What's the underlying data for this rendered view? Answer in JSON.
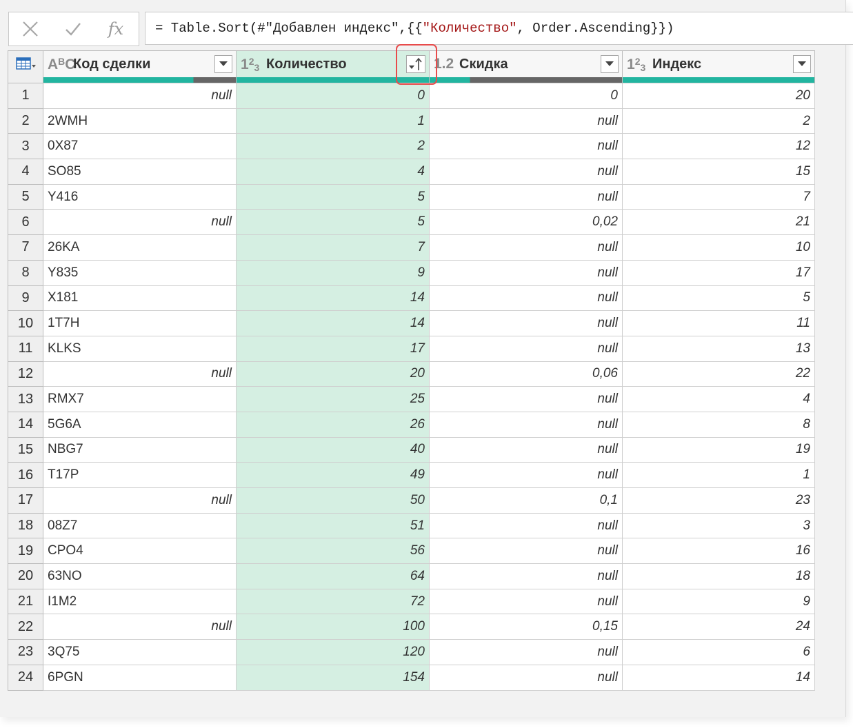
{
  "formula_bar": {
    "cancel_icon": "close-icon",
    "confirm_icon": "check-icon",
    "fx_label": "fx",
    "formula_prefix": "= Table.Sort(#\"Добавлен индекс\",{{",
    "formula_string": "\"Количество\"",
    "formula_suffix": ", Order.Ascending}})"
  },
  "colors": {
    "quality_green": "#22b5a0",
    "quality_gray": "#666666",
    "sorted_column_bg": "#d5efe2",
    "highlight_red": "#e84b4b",
    "string_literal": "#a31515"
  },
  "table": {
    "corner_icon": "table-icon",
    "columns": [
      {
        "key": "code",
        "label": "Код сделки",
        "type_icon": "ABC",
        "quality_valid": 0.78
      },
      {
        "key": "qty",
        "label": "Количество",
        "type_icon": "123",
        "quality_valid": 1.0,
        "sorted": "ascending"
      },
      {
        "key": "discount",
        "label": "Скидка",
        "type_icon": "1.2",
        "quality_valid": 0.21
      },
      {
        "key": "index",
        "label": "Индекс",
        "type_icon": "123",
        "quality_valid": 1.0
      }
    ],
    "rows": [
      {
        "n": "1",
        "code": "null",
        "qty": "0",
        "discount": "0",
        "index": "20"
      },
      {
        "n": "2",
        "code": "2WMH",
        "qty": "1",
        "discount": "null",
        "index": "2"
      },
      {
        "n": "3",
        "code": "0X87",
        "qty": "2",
        "discount": "null",
        "index": "12"
      },
      {
        "n": "4",
        "code": "SO85",
        "qty": "4",
        "discount": "null",
        "index": "15"
      },
      {
        "n": "5",
        "code": "Y416",
        "qty": "5",
        "discount": "null",
        "index": "7"
      },
      {
        "n": "6",
        "code": "null",
        "qty": "5",
        "discount": "0,02",
        "index": "21"
      },
      {
        "n": "7",
        "code": "26KA",
        "qty": "7",
        "discount": "null",
        "index": "10"
      },
      {
        "n": "8",
        "code": "Y835",
        "qty": "9",
        "discount": "null",
        "index": "17"
      },
      {
        "n": "9",
        "code": "X181",
        "qty": "14",
        "discount": "null",
        "index": "5"
      },
      {
        "n": "10",
        "code": "1T7H",
        "qty": "14",
        "discount": "null",
        "index": "11"
      },
      {
        "n": "11",
        "code": "KLKS",
        "qty": "17",
        "discount": "null",
        "index": "13"
      },
      {
        "n": "12",
        "code": "null",
        "qty": "20",
        "discount": "0,06",
        "index": "22"
      },
      {
        "n": "13",
        "code": "RMX7",
        "qty": "25",
        "discount": "null",
        "index": "4"
      },
      {
        "n": "14",
        "code": "5G6A",
        "qty": "26",
        "discount": "null",
        "index": "8"
      },
      {
        "n": "15",
        "code": "NBG7",
        "qty": "40",
        "discount": "null",
        "index": "19"
      },
      {
        "n": "16",
        "code": "T17P",
        "qty": "49",
        "discount": "null",
        "index": "1"
      },
      {
        "n": "17",
        "code": "null",
        "qty": "50",
        "discount": "0,1",
        "index": "23"
      },
      {
        "n": "18",
        "code": "08Z7",
        "qty": "51",
        "discount": "null",
        "index": "3"
      },
      {
        "n": "19",
        "code": "CPO4",
        "qty": "56",
        "discount": "null",
        "index": "16"
      },
      {
        "n": "20",
        "code": "63NO",
        "qty": "64",
        "discount": "null",
        "index": "18"
      },
      {
        "n": "21",
        "code": "I1M2",
        "qty": "72",
        "discount": "null",
        "index": "9"
      },
      {
        "n": "22",
        "code": "null",
        "qty": "100",
        "discount": "0,15",
        "index": "24"
      },
      {
        "n": "23",
        "code": "3Q75",
        "qty": "120",
        "discount": "null",
        "index": "6"
      },
      {
        "n": "24",
        "code": "6PGN",
        "qty": "154",
        "discount": "null",
        "index": "14"
      }
    ]
  }
}
